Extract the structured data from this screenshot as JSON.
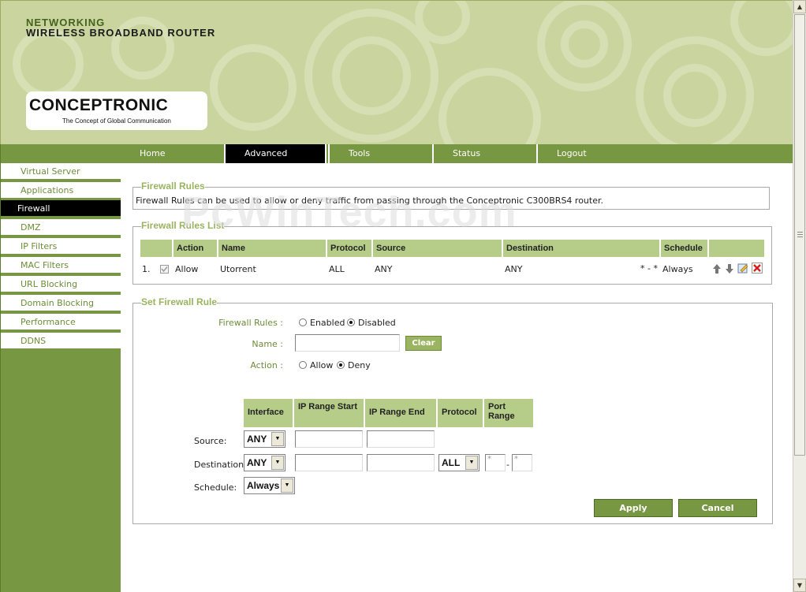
{
  "header": {
    "line1": "NETWORKING",
    "line2": "WIRELESS BROADBAND ROUTER",
    "brand": "CONCEPTRONIC",
    "tagline": "The Concept of Global Communication"
  },
  "nav": {
    "tabs": [
      {
        "label": "Home"
      },
      {
        "label": "Advanced",
        "active": true
      },
      {
        "label": "Tools"
      },
      {
        "label": "Status"
      },
      {
        "label": "Logout"
      }
    ]
  },
  "sidebar": {
    "items": [
      {
        "label": "Virtual Server"
      },
      {
        "label": "Applications"
      },
      {
        "label": "Firewall",
        "active": true
      },
      {
        "label": "DMZ"
      },
      {
        "label": "IP Filters"
      },
      {
        "label": "MAC Filters"
      },
      {
        "label": "URL Blocking"
      },
      {
        "label": "Domain Blocking"
      },
      {
        "label": "Performance"
      },
      {
        "label": "DDNS"
      }
    ]
  },
  "firewall_rules": {
    "legend": "Firewall Rules",
    "description": "Firewall Rules can be used to allow or deny traffic from passing through the Conceptronic C300BRS4 router."
  },
  "rules_list": {
    "legend": "Firewall Rules List",
    "headers": [
      "Action",
      "Name",
      "Protocol",
      "Source",
      "Destination",
      "Schedule"
    ],
    "rows": [
      {
        "index": "1.",
        "checked": true,
        "action": "Allow",
        "name": "Utorrent",
        "protocol": "ALL",
        "source": "ANY",
        "destination": "ANY",
        "ports": "* - *",
        "schedule": "Always"
      }
    ]
  },
  "set_rule": {
    "legend": "Set Firewall Rule",
    "firewall_rules_label": "Firewall Rules :",
    "enabled_label": "Enabled",
    "disabled_label": "Disabled",
    "state": "Disabled",
    "name_label": "Name :",
    "name_value": "",
    "clear_label": "Clear",
    "action_label": "Action :",
    "allow_label": "Allow",
    "deny_label": "Deny",
    "action": "Deny",
    "col_interface": "Interface",
    "col_ip_start": "IP Range Start",
    "col_ip_end": "IP Range End",
    "col_protocol": "Protocol",
    "col_port_range": "Port Range",
    "source_label": "Source:",
    "source_interface": "ANY",
    "destination_label": "Destination:",
    "destination_interface": "ANY",
    "destination_protocol": "ALL",
    "port_start": "*",
    "port_sep": "-",
    "port_end": "*",
    "schedule_label": "Schedule:",
    "schedule": "Always",
    "apply_label": "Apply",
    "cancel_label": "Cancel"
  },
  "watermark": "PcWinTech.com",
  "colors": {
    "accent": "#789743",
    "header_bg": "#c9d49f",
    "table_header": "#b6cc89",
    "legend": "#9ab462"
  }
}
